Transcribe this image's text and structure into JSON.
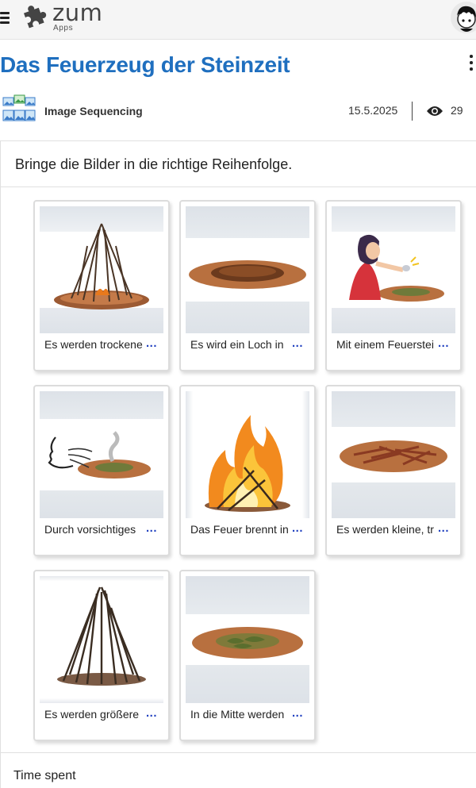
{
  "appbar": {
    "menu_icon": "hamburger-icon",
    "logo_text": "ZUM",
    "logo_sub": "Apps",
    "logo_icon": "puzzle-icon",
    "avatar_icon": "user-avatar-icon"
  },
  "page": {
    "title": "Das Feuerzeug der Steinzeit",
    "menu_icon": "kebab-icon"
  },
  "meta": {
    "type_icon": "image-sequencing-icon",
    "type_label": "Image Sequencing",
    "date": "15.5.2025",
    "views_icon": "eye-icon",
    "views": "29"
  },
  "task": {
    "instruction": "Bringe die Bilder in die richtige Reihenfolge.",
    "more_label": "...",
    "cards": [
      {
        "caption": "Es werden trockene",
        "image": "stick-pile-burning"
      },
      {
        "caption": "Es wird ein Loch in",
        "image": "dug-hole"
      },
      {
        "caption": "Mit einem Feuerstei",
        "image": "woman-striking-flint"
      },
      {
        "caption": "Durch vorsichtiges",
        "image": "person-blowing-smoke"
      },
      {
        "caption": "Das Feuer brennt in",
        "image": "large-fire"
      },
      {
        "caption": "Es werden kleine, tr",
        "image": "small-twigs-on-ground"
      },
      {
        "caption": "Es werden größere",
        "image": "large-stick-pile"
      },
      {
        "caption": "In die Mitte werden",
        "image": "leaves-in-center"
      }
    ]
  },
  "footer": {
    "time_spent_label": "Time spent"
  },
  "colors": {
    "title": "#1f6fbf",
    "more_link": "#1f3fbf",
    "appbar_bg": "#f5f5f5"
  }
}
